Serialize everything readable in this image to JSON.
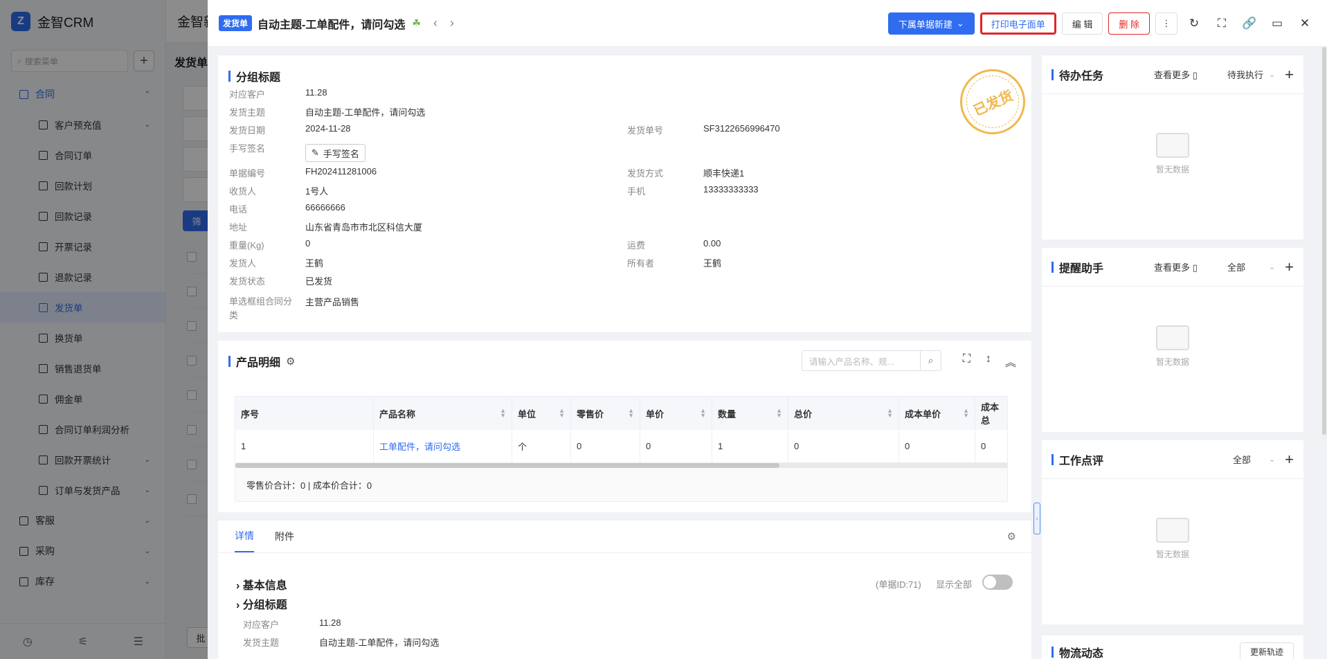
{
  "app": {
    "name": "金智CRM",
    "search_placeholder": "搜索菜单"
  },
  "menu": [
    {
      "label": "合同",
      "level": "top",
      "state": "open",
      "chev": "⌃"
    },
    {
      "label": "客户预充值",
      "level": "sub",
      "chev": "⌄"
    },
    {
      "label": "合同订单",
      "level": "sub"
    },
    {
      "label": "回款计划",
      "level": "sub"
    },
    {
      "label": "回款记录",
      "level": "sub"
    },
    {
      "label": "开票记录",
      "level": "sub"
    },
    {
      "label": "退款记录",
      "level": "sub"
    },
    {
      "label": "发货单",
      "level": "sub",
      "state": "active"
    },
    {
      "label": "换货单",
      "level": "sub"
    },
    {
      "label": "销售退货单",
      "level": "sub"
    },
    {
      "label": "佣金单",
      "level": "sub"
    },
    {
      "label": "合同订单利润分析",
      "level": "sub"
    },
    {
      "label": "回款开票统计",
      "level": "sub",
      "chev": "⌄"
    },
    {
      "label": "订单与发货产品",
      "level": "sub",
      "chev": "⌄"
    },
    {
      "label": "客服",
      "level": "top",
      "chev": "⌄"
    },
    {
      "label": "采购",
      "level": "top",
      "chev": "⌄"
    },
    {
      "label": "库存",
      "level": "top",
      "chev": "⌄"
    }
  ],
  "listpage": {
    "header": "金智新",
    "title": "发货单",
    "filter_btn": "筛",
    "bulk_btn": "批"
  },
  "drawer": {
    "tag": "发货单",
    "title": "自动主题-工单配件，请问勾选",
    "buttons": {
      "new_sub": "下属单据新建",
      "print": "打印电子面单",
      "edit": "编 辑",
      "delete": "删 除"
    },
    "group_title": "分组标题",
    "stamp": "已发货",
    "fields_left": [
      {
        "k": "对应客户",
        "v": "11.28",
        "link": true
      },
      {
        "k": "发货主题",
        "v": "自动主题-工单配件，请问勾选"
      },
      {
        "k": "发货日期",
        "v": "2024-11-28"
      },
      {
        "k": "手写签名",
        "v": ""
      },
      {
        "k": "单据编号",
        "v": "FH202411281006"
      },
      {
        "k": "收货人",
        "v": "1号人"
      },
      {
        "k": "电话",
        "v": "66666666"
      },
      {
        "k": "地址",
        "v": "山东省青岛市市北区科信大厦"
      },
      {
        "k": "重量(Kg)",
        "v": "0"
      },
      {
        "k": "发货人",
        "v": "王鹤"
      },
      {
        "k": "发货状态",
        "v": "已发货"
      },
      {
        "k": "单选框组合同分类",
        "v": "主营产品销售"
      }
    ],
    "signature_btn": "手写签名",
    "fields_right": [
      {
        "k": "发货单号",
        "v": "SF3122656996470"
      },
      {
        "k": "发货方式",
        "v": "顺丰快递1"
      },
      {
        "k": "手机",
        "v": "13333333333"
      },
      {
        "k": "运费",
        "v": "0.00"
      },
      {
        "k": "所有者",
        "v": "王鹤"
      }
    ],
    "products": {
      "title": "产品明细",
      "search_placeholder": "请输入产品名称、规...",
      "columns": [
        "序号",
        "产品名称",
        "单位",
        "零售价",
        "单价",
        "数量",
        "总价",
        "成本单价",
        "成本总"
      ],
      "rows": [
        [
          "1",
          "工单配件，请问勾选",
          "个",
          "0",
          "0",
          "1",
          "0",
          "0",
          "0"
        ]
      ],
      "totals": "零售价合计：0 |   成本价合计：0"
    },
    "tabs": [
      "详情",
      "附件"
    ],
    "detail": {
      "basic": "基本信息",
      "group": "分组标题",
      "doc_id": "(单据ID:71)",
      "show_all": "显示全部",
      "fields": [
        {
          "k": "对应客户",
          "v": "11.28",
          "link": true
        },
        {
          "k": "发货主题",
          "v": "自动主题-工单配件，请问勾选"
        }
      ]
    }
  },
  "right": {
    "todo": {
      "title": "待办任务",
      "more": "查看更多",
      "select": "待我执行",
      "empty": "暂无数据"
    },
    "remind": {
      "title": "提醒助手",
      "more": "查看更多",
      "select": "全部",
      "empty": "暂无数据"
    },
    "review": {
      "title": "工作点评",
      "select": "全部",
      "empty": "暂无数据"
    },
    "logistics": {
      "title": "物流动态",
      "refresh": "更新轨迹"
    }
  }
}
